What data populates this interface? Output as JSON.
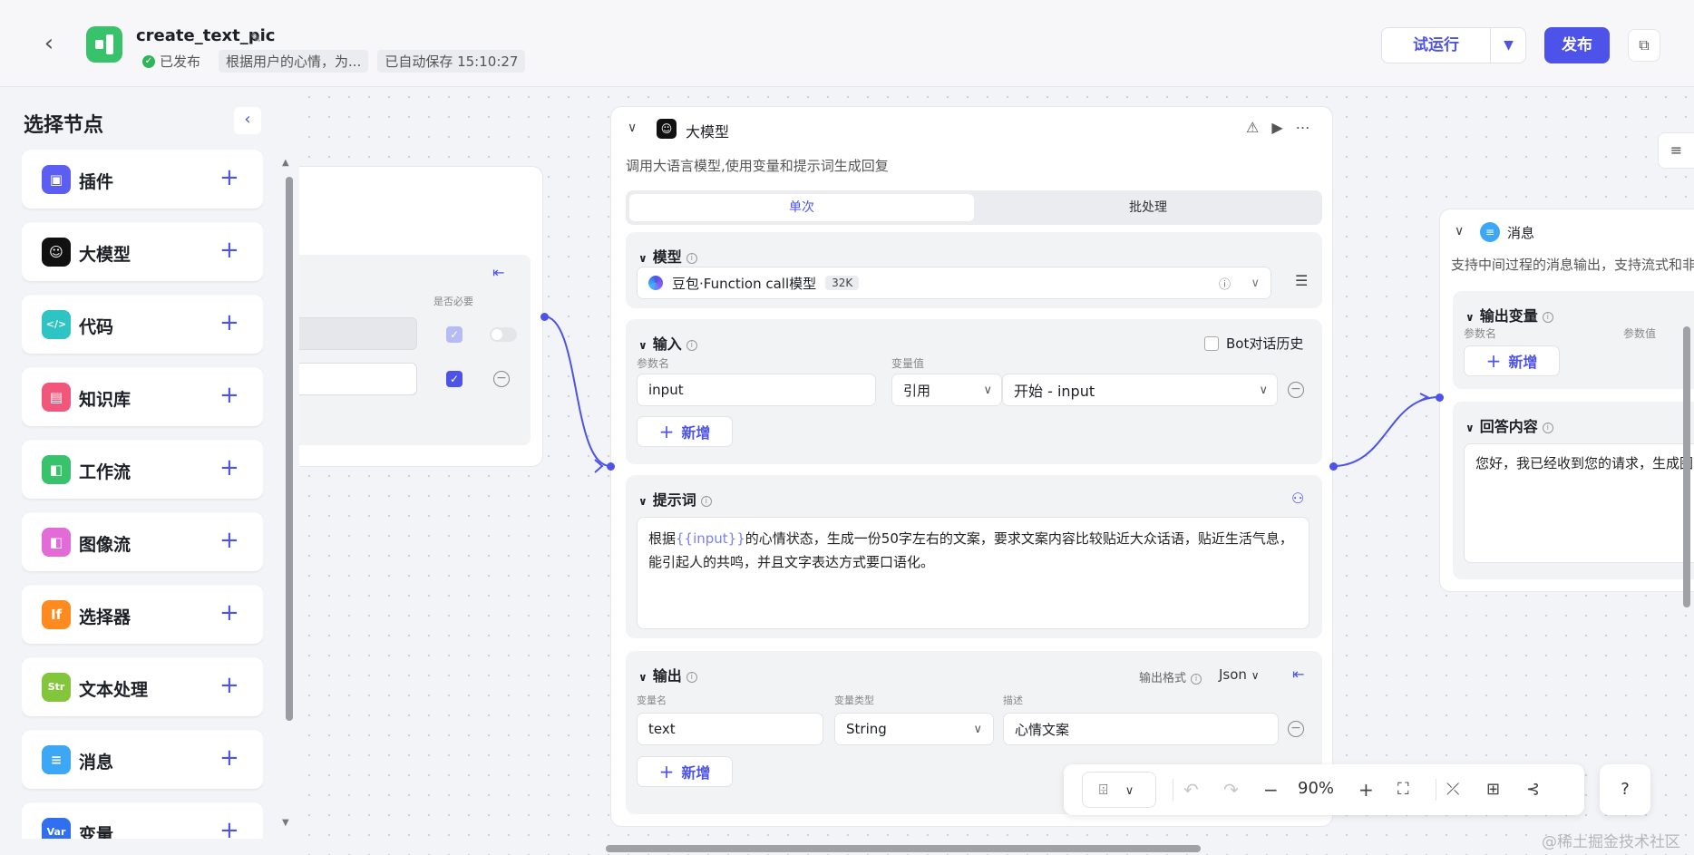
{
  "header": {
    "title": "create_text_pic",
    "status": "已发布",
    "description": "根据用户的心情，为...",
    "autosave": "已自动保存 15:10:27",
    "run_label": "试运行",
    "publish_label": "发布"
  },
  "panel": {
    "title": "选择节点",
    "items": [
      {
        "label": "插件",
        "icon": "cube-icon",
        "color": "#5b5ef0",
        "glyph": "▣"
      },
      {
        "label": "大模型",
        "icon": "llm-icon",
        "color": "#111111",
        "glyph": "☺"
      },
      {
        "label": "代码",
        "icon": "code-icon",
        "color": "#2ec4c4",
        "glyph": "</>"
      },
      {
        "label": "知识库",
        "icon": "knowledge-icon",
        "color": "#f0577a",
        "glyph": "▤"
      },
      {
        "label": "工作流",
        "icon": "workflow-icon",
        "color": "#37c26b",
        "glyph": "◧"
      },
      {
        "label": "图像流",
        "icon": "imageflow-icon",
        "color": "#e26bd8",
        "glyph": "◧"
      },
      {
        "label": "选择器",
        "icon": "if-icon",
        "color": "#ff8a1f",
        "glyph": "If"
      },
      {
        "label": "文本处理",
        "icon": "text-process-icon",
        "color": "#84c63b",
        "glyph": "Str"
      },
      {
        "label": "消息",
        "icon": "message-icon",
        "color": "#3ba7f5",
        "glyph": "≡"
      },
      {
        "label": "变量",
        "icon": "variable-icon",
        "color": "#2f6ff0",
        "glyph": "Var"
      }
    ]
  },
  "start_node": {
    "required_label": "是否必要"
  },
  "llm_node": {
    "title": "大模型",
    "description": "调用大语言模型,使用变量和提示词生成回复",
    "tabs": [
      "单次",
      "批处理"
    ],
    "model": {
      "label": "模型",
      "name": "豆包·Function call模型",
      "badge": "32K"
    },
    "input": {
      "label": "输入",
      "bot_history": "Bot对话历史",
      "param_name_label": "参数名",
      "param_value_label": "变量值",
      "param_name": "input",
      "ref_type": "引用",
      "ref_value": "开始 - input",
      "add_label": "新增"
    },
    "prompt": {
      "label": "提示词",
      "text_before": "根据",
      "variable": "{{input}}",
      "text_after": "的心情状态，生成一份50字左右的文案，要求文案内容比较贴近大众话语，贴近生活气息，能引起人的共鸣，并且文字表达方式要口语化。"
    },
    "output": {
      "label": "输出",
      "format_label": "输出格式",
      "format": "Json",
      "var_name_label": "变量名",
      "var_type_label": "变量类型",
      "desc_label": "描述",
      "var_name": "text",
      "var_type": "String",
      "desc": "心情文案",
      "add_label": "新增"
    }
  },
  "message_node": {
    "title": "消息",
    "description": "支持中间过程的消息输出，支持流式和非",
    "output_vars_label": "输出变量",
    "param_name_label": "参数名",
    "param_value_label": "参数值",
    "add_label": "新增",
    "answer_label": "回答内容",
    "answer_text": "您好，我已经收到您的请求，生成图"
  },
  "zoombar": {
    "zoom": "90%"
  },
  "watermark": "@稀土掘金技术社区"
}
